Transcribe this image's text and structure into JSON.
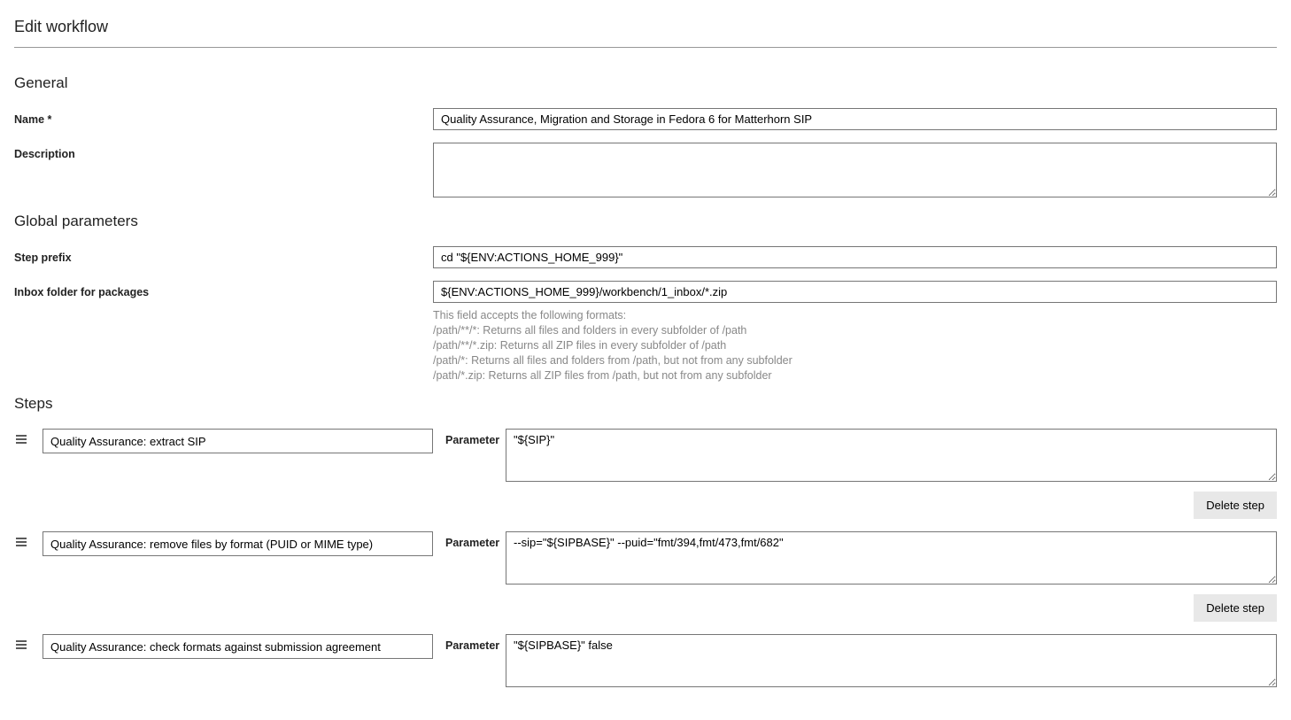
{
  "page_title": "Edit workflow",
  "general": {
    "heading": "General",
    "name_label": "Name *",
    "name_value": "Quality Assurance, Migration and Storage in Fedora 6 for Matterhorn SIP",
    "description_label": "Description",
    "description_value": ""
  },
  "global_params": {
    "heading": "Global parameters",
    "step_prefix_label": "Step prefix",
    "step_prefix_value": "cd \"${ENV:ACTIONS_HOME_999}\"",
    "inbox_label": "Inbox folder for packages",
    "inbox_value": "${ENV:ACTIONS_HOME_999}/workbench/1_inbox/*.zip",
    "help_intro": "This field accepts the following formats:",
    "help_lines": [
      "/path/**/*: Returns all files and folders in every subfolder of /path",
      "/path/**/*.zip: Returns all ZIP files in every subfolder of /path",
      "/path/*: Returns all files and folders from /path, but not from any subfolder",
      "/path/*.zip: Returns all ZIP files from /path, but not from any subfolder"
    ]
  },
  "steps_heading": "Steps",
  "parameter_label": "Parameter",
  "delete_label": "Delete step",
  "steps": [
    {
      "name": "Quality Assurance: extract SIP",
      "parameter": "\"${SIP}\""
    },
    {
      "name": "Quality Assurance: remove files by format (PUID or MIME type)",
      "parameter": "--sip=\"${SIPBASE}\" --puid=\"fmt/394,fmt/473,fmt/682\""
    },
    {
      "name": "Quality Assurance: check formats against submission agreement",
      "parameter": "\"${SIPBASE}\" false"
    }
  ]
}
